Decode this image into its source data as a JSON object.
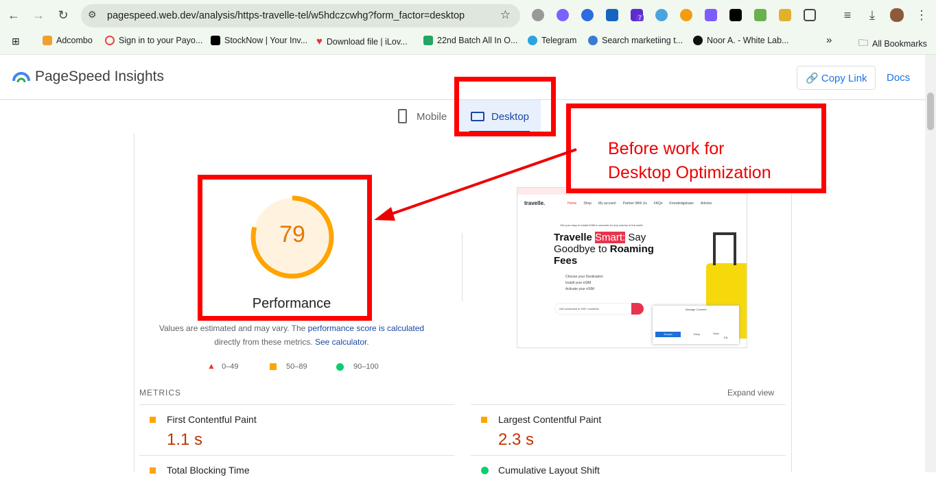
{
  "browser": {
    "url": "pagespeed.web.dev/analysis/https-travelle-tel/w5hdczcwhg?form_factor=desktop",
    "bookmarks": [
      "Adcombo",
      "Sign in to your Payo...",
      "StockNow | Your Inv...",
      "Download file | iLov...",
      "22nd Batch All In O...",
      "Telegram",
      "Search marketiing t...",
      "Noor A. - White Lab..."
    ],
    "more": "»",
    "all_bookmarks": "All Bookmarks",
    "ext_badge": "7"
  },
  "header": {
    "title": "PageSpeed Insights",
    "copy_link": "Copy Link",
    "docs": "Docs"
  },
  "tabs": {
    "mobile": "Mobile",
    "desktop": "Desktop"
  },
  "annotation": {
    "line1": "Before work for",
    "line2": "Desktop Optimization"
  },
  "score": {
    "value": "79",
    "fraction": 0.79,
    "label": "Performance",
    "color": "#ffa400"
  },
  "note": {
    "text1": "Values are estimated and may vary. The ",
    "link1": "performance score is calculated",
    "text2": "directly from these metrics. ",
    "link2": "See calculator",
    "text3": "."
  },
  "legend": [
    "0–49",
    "50–89",
    "90–100"
  ],
  "screenshot": {
    "logo": "travelle.",
    "nav": [
      "Home",
      "Shop",
      "My account",
      "Partner With Us",
      "FAQs",
      "Knowledgebase",
      "Articles"
    ],
    "tagline": "Get your easy to install eSIM in seconds for any country in the world.",
    "h1a": "Travelle ",
    "h1b": "Smart:",
    "h1c": " Say",
    "h2a": "Goodbye to ",
    "h2b": "Roaming",
    "h3": "Fees",
    "steps": [
      "Choose your Destination",
      "Install your eSIM",
      "Activate your eSIM"
    ],
    "search": "Get connected in 200+ countries",
    "consent_title": "Manage Consent",
    "accept": "Accept",
    "deny": "Deny",
    "view": "View",
    "lang": "EN"
  },
  "metrics": {
    "heading": "METRICS",
    "expand": "Expand view",
    "items": [
      {
        "label": "First Contentful Paint",
        "value": "1.1 s"
      },
      {
        "label": "Largest Contentful Paint",
        "value": "2.3 s"
      },
      {
        "label": "Total Blocking Time",
        "value": ""
      },
      {
        "label": "Cumulative Layout Shift",
        "value": ""
      }
    ]
  }
}
